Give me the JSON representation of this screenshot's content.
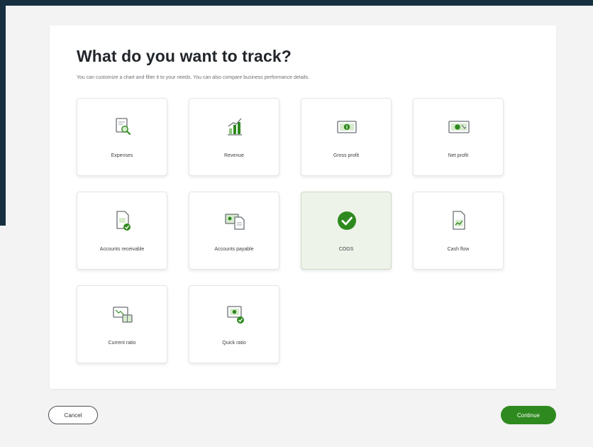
{
  "dialog": {
    "title": "What do you want to track?",
    "subtitle": "You can customize a chart and filter it to your needs. You can also compare business performance details."
  },
  "options": [
    {
      "label": "Expenses",
      "icon": "expenses-icon",
      "selected": false
    },
    {
      "label": "Revenue",
      "icon": "revenue-icon",
      "selected": false
    },
    {
      "label": "Gross profit",
      "icon": "gross-profit-icon",
      "selected": false
    },
    {
      "label": "Net profit",
      "icon": "net-profit-icon",
      "selected": false
    },
    {
      "label": "Accounts receivable",
      "icon": "accounts-receivable-icon",
      "selected": false
    },
    {
      "label": "Accounts payable",
      "icon": "accounts-payable-icon",
      "selected": false
    },
    {
      "label": "COGS",
      "icon": "checkmark-icon",
      "selected": true
    },
    {
      "label": "Cash flow",
      "icon": "cash-flow-icon",
      "selected": false
    },
    {
      "label": "Current ratio",
      "icon": "current-ratio-icon",
      "selected": false
    },
    {
      "label": "Quick ratio",
      "icon": "quick-ratio-icon",
      "selected": false
    }
  ],
  "footer": {
    "cancel_label": "Cancel",
    "continue_label": "Continue"
  },
  "colors": {
    "brand_green": "#2e8a1e",
    "selected_tile_bg": "#eef3ea",
    "backdrop_dark": "#163040"
  }
}
